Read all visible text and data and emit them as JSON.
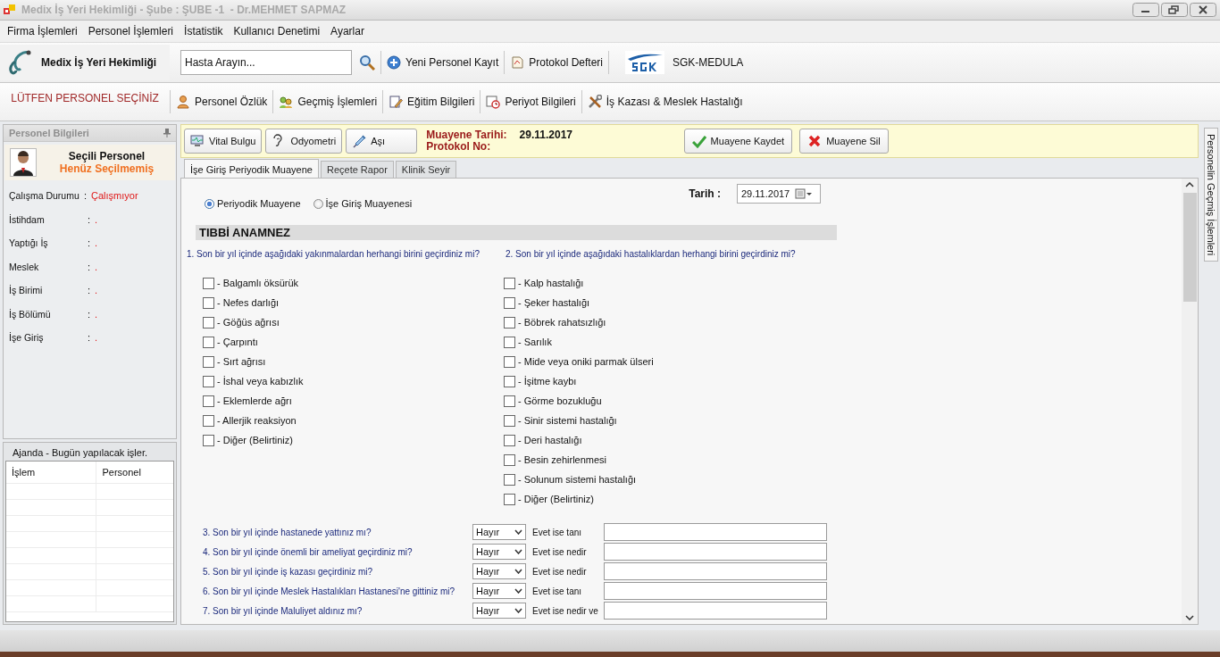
{
  "window": {
    "title": "Medix İş Yeri Hekimliği - Şube : ŞUBE -1  - Dr.MEHMET SAPMAZ"
  },
  "menu": [
    "Firma İşlemleri",
    "Personel İşlemleri",
    "İstatistik",
    "Kullanıcı Denetimi",
    "Ayarlar"
  ],
  "toolbar": {
    "app_name": "Medix İş Yeri Hekimliği",
    "search": {
      "placeholder": "Hasta Arayın..."
    },
    "buttons": [
      {
        "label": "Yeni Personel Kayıt",
        "kind": "plus"
      },
      {
        "label": "Protokol Defteri",
        "kind": "book"
      },
      {
        "label": "SGK-MEDULA",
        "kind": "sgk"
      }
    ]
  },
  "personnel_bar": {
    "notice": "LÜTFEN PERSONEL SEÇİNİZ",
    "buttons": [
      {
        "label": "Personel Özlük",
        "kind": "person"
      },
      {
        "label": "Geçmiş İşlemleri",
        "kind": "history"
      },
      {
        "label": "Eğitim Bilgileri",
        "kind": "education"
      },
      {
        "label": "Periyot Bilgileri",
        "kind": "period"
      },
      {
        "label": "İş Kazası & Meslek Hastalığı",
        "kind": "tools"
      }
    ]
  },
  "personnel_panel": {
    "title": "Personel Bilgileri",
    "card": {
      "heading": "Seçili Personel",
      "name": "Henüz Seçilmemiş"
    },
    "fields": [
      {
        "label": "Çalışma Durumu",
        "separator": ":",
        "value": "Çalışmıyor"
      },
      {
        "label": "İstihdam",
        "separator": ":",
        "value": "."
      },
      {
        "label": "Yaptığı İş",
        "separator": ":",
        "value": "."
      },
      {
        "label": "Meslek",
        "separator": ":",
        "value": "."
      },
      {
        "label": "İş Birimi",
        "separator": ":",
        "value": "."
      },
      {
        "label": "İş Bölümü",
        "separator": ":",
        "value": "."
      },
      {
        "label": "İşe Giriş",
        "separator": ":",
        "value": "."
      }
    ]
  },
  "agenda": {
    "title": "Ajanda - Bugün yapılacak işler.",
    "columns": [
      "İşlem",
      "Personel"
    ]
  },
  "exam_bar": {
    "tools": [
      {
        "label": "Vital Bulgu",
        "kind": "vital"
      },
      {
        "label": "Odyometri",
        "kind": "ear"
      },
      {
        "label": "Aşı",
        "kind": "syringe"
      }
    ],
    "date_label": "Muayene Tarihi:",
    "date": "29.11.2017",
    "protocol_label": "Protokol No:",
    "actions": [
      {
        "label": "Muayene Kaydet",
        "kind": "save"
      },
      {
        "label": "Muayene Sil",
        "kind": "delete"
      }
    ]
  },
  "tabs": [
    {
      "label": "İşe Giriş Periyodik Muayene",
      "selected": true
    },
    {
      "label": "Reçete Rapor",
      "selected": false
    },
    {
      "label": "Klinik Seyir",
      "selected": false
    }
  ],
  "form": {
    "exam_types": [
      {
        "label": "Periyodik Muayene",
        "selected": true
      },
      {
        "label": "İşe Giriş Muayenesi",
        "selected": false
      }
    ],
    "date": {
      "label": "Tarih :",
      "value": "29.11.2017"
    },
    "section_title": "TIBBİ ANAMNEZ",
    "groups": [
      {
        "question": "1. Son bir yıl içinde aşağıdaki yakınmalardan herhangi birini geçirdiniz mi?",
        "options": [
          {
            "label": "- Balgamlı öksürük",
            "checked": false
          },
          {
            "label": "- Nefes darlığı",
            "checked": false
          },
          {
            "label": "- Göğüs ağrısı",
            "checked": false
          },
          {
            "label": "- Çarpıntı",
            "checked": false
          },
          {
            "label": "- Sırt ağrısı",
            "checked": false
          },
          {
            "label": "- İshal veya kabızlık",
            "checked": false
          },
          {
            "label": "- Eklemlerde ağrı",
            "checked": false
          },
          {
            "label": "- Allerjik reaksiyon",
            "checked": false
          },
          {
            "label": "- Diğer (Belirtiniz)",
            "checked": false
          }
        ]
      },
      {
        "question": "2. Son bir yıl içinde aşağıdaki hastalıklardan herhangi birini geçirdiniz mi?",
        "options": [
          {
            "label": "- Kalp hastalığı",
            "checked": false
          },
          {
            "label": "- Şeker hastalığı",
            "checked": false
          },
          {
            "label": "- Böbrek rahatsızlığı",
            "checked": false
          },
          {
            "label": "- Sarılık",
            "checked": false
          },
          {
            "label": "- Mide veya oniki parmak ülseri",
            "checked": false
          },
          {
            "label": "- İşitme kaybı",
            "checked": false
          },
          {
            "label": "- Görme bozukluğu",
            "checked": false
          },
          {
            "label": "- Sinir sistemi hastalığı",
            "checked": false
          },
          {
            "label": "- Deri hastalığı",
            "checked": false
          },
          {
            "label": "- Besin zehirlenmesi",
            "checked": false
          },
          {
            "label": "- Solunum sistemi hastalığı",
            "checked": false
          },
          {
            "label": "- Diğer (Belirtiniz)",
            "checked": false
          }
        ]
      }
    ],
    "questions": [
      {
        "question": "3. Son bir yıl içinde hastanede yattınız mı?",
        "answer": "Hayır",
        "detail_label": "Evet ise tanı"
      },
      {
        "question": "4. Son bir yıl içinde önemli bir ameliyat geçirdiniz mi?",
        "answer": "Hayır",
        "detail_label": "Evet ise nedir"
      },
      {
        "question": "5. Son bir yıl içinde iş kazası geçirdiniz mi?",
        "answer": "Hayır",
        "detail_label": "Evet ise nedir"
      },
      {
        "question": "6. Son bir yıl içinde Meslek Hastalıkları Hastanesi'ne gittiniz mi?",
        "answer": "Hayır",
        "detail_label": "Evet ise tanı"
      },
      {
        "question": "7. Son bir yıl içinde Maluliyet aldınız mı?",
        "answer": "Hayır",
        "detail_label": "Evet ise nedir ve"
      }
    ]
  },
  "side_tab": "Personelin Geçmiş İşlemleri"
}
